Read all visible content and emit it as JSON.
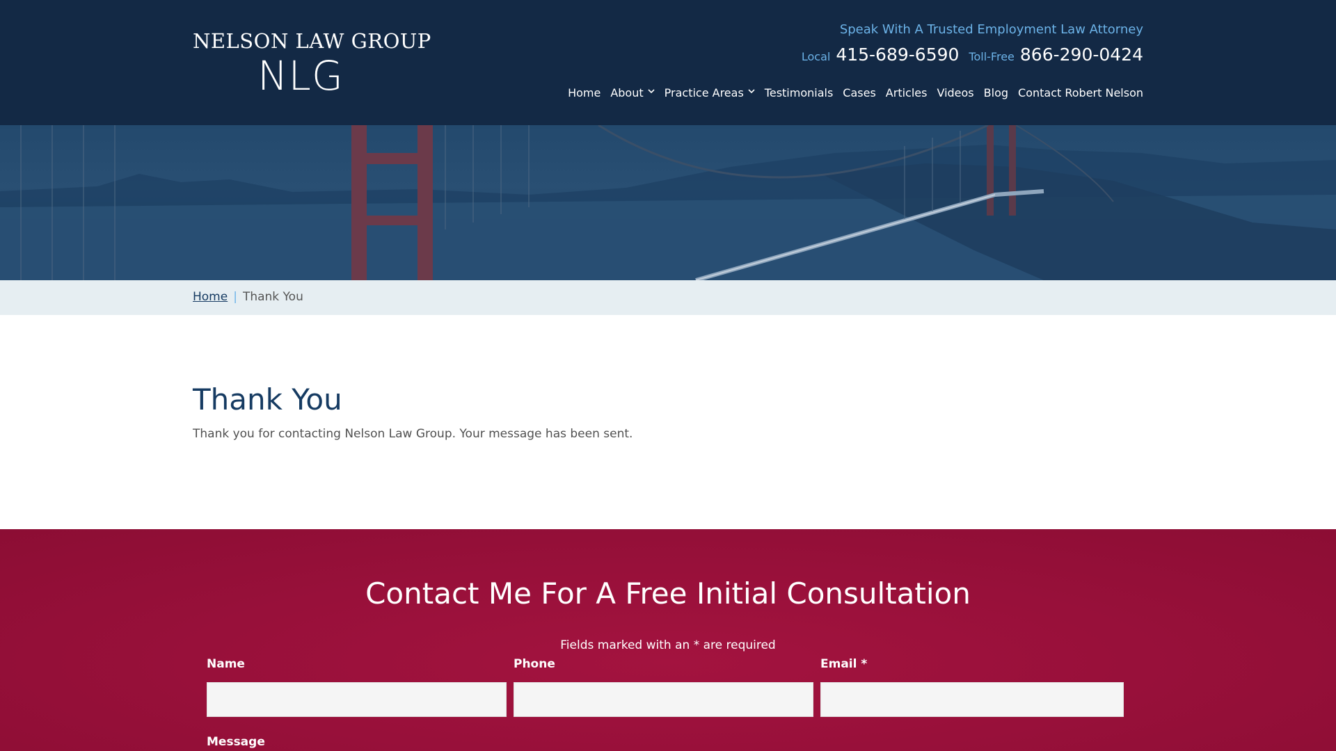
{
  "header": {
    "logo_top": "NELSON LAW GROUP",
    "logo_mark": "NLG",
    "tagline": "Speak With A Trusted Employment Law Attorney",
    "local_label": "Local",
    "local_number": "415-689-6590",
    "tollfree_label": "Toll-Free",
    "tollfree_number": "866-290-0424"
  },
  "nav": {
    "items": [
      {
        "label": "Home"
      },
      {
        "label": "About",
        "dropdown": true
      },
      {
        "label": "Practice Areas",
        "dropdown": true
      },
      {
        "label": "Testimonials"
      },
      {
        "label": "Cases"
      },
      {
        "label": "Articles"
      },
      {
        "label": "Videos"
      },
      {
        "label": "Blog"
      },
      {
        "label": "Contact Robert Nelson"
      }
    ],
    "chevron": "⌄"
  },
  "breadcrumb": {
    "home": "Home",
    "separator": "|",
    "current": "Thank You"
  },
  "main": {
    "title": "Thank You",
    "message": "Thank you for contacting Nelson Law Group. Your message has been sent."
  },
  "contact": {
    "title": "Contact Me For A Free Initial Consultation",
    "required_note": "Fields marked with an * are required",
    "fields": {
      "name": "Name",
      "phone": "Phone",
      "email": "Email *",
      "message": "Message"
    }
  },
  "colors": {
    "header_bg": "#132945",
    "accent_blue": "#6cb3e8",
    "title_blue": "#163b62",
    "contact_bg": "#98103a"
  }
}
